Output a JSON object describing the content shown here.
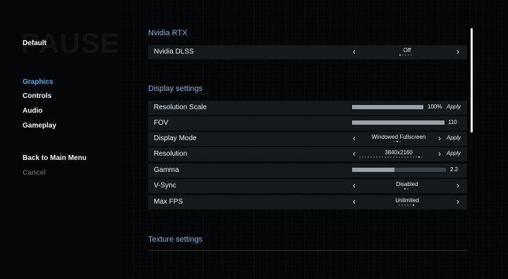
{
  "nav": {
    "profile": "Default",
    "items": [
      {
        "label": "Graphics"
      },
      {
        "label": "Controls"
      },
      {
        "label": "Audio"
      },
      {
        "label": "Gameplay"
      }
    ],
    "back": "Back to Main Menu",
    "cancel": "Cancel"
  },
  "sections": {
    "rtx": {
      "title": "Nvidia RTX"
    },
    "display": {
      "title": "Display settings"
    },
    "texture": {
      "title": "Texture settings"
    }
  },
  "rows": {
    "dlss": {
      "label": "Nvidia DLSS",
      "value": "Off",
      "options_count": 5,
      "selected_index": 0
    },
    "resolution_scale": {
      "label": "Resolution Scale",
      "value_text": "100%",
      "level": 1.0,
      "apply": "Apply"
    },
    "fov": {
      "label": "FOV",
      "value_text": "110",
      "level": 1.0
    },
    "display_mode": {
      "label": "Display Mode",
      "value": "Windowed Fullscreen",
      "options_count": 3,
      "selected_index": 1,
      "apply": "Apply"
    },
    "resolution": {
      "label": "Resolution",
      "value": "3840x2160",
      "options_count": 23,
      "selected_index": 21,
      "apply": "Apply"
    },
    "gamma": {
      "label": "Gamma",
      "value_text": "2.2",
      "level": 0.45
    },
    "vsync": {
      "label": "V-Sync",
      "value": "Disabled",
      "options_count": 2,
      "selected_index": 0
    },
    "max_fps": {
      "label": "Max FPS",
      "value": "Unlimited",
      "options_count": 6,
      "selected_index": 5
    }
  },
  "glyphs": {
    "left": "‹",
    "right": "›"
  },
  "colors": {
    "accent": "#5aa8de",
    "section": "#7fb5dd",
    "row_bg": "#16191c"
  }
}
